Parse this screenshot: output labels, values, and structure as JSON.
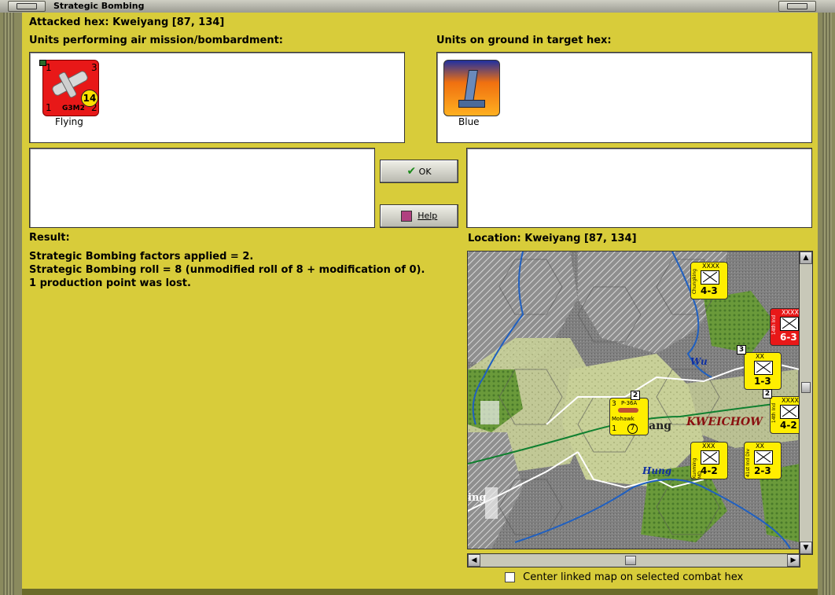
{
  "window": {
    "title": "Strategic Bombing"
  },
  "attacked_hex": "Attacked hex: Kweiyang  [87, 134]",
  "air_units": {
    "label": "Units performing air mission/bombardment:",
    "unit": {
      "type": "G3M2",
      "strength": "14",
      "top_left": "1",
      "top_right": "3",
      "bottom_left": "1",
      "bottom_right": "2",
      "caption": "Flying",
      "icon": "bomber-plane-icon"
    }
  },
  "ground_units": {
    "label": "Units on ground in target hex:",
    "unit": {
      "caption": "Blue",
      "icon": "factory-tower-icon"
    }
  },
  "buttons": {
    "ok": "OK",
    "help": "Help"
  },
  "result": {
    "label": "Result:",
    "lines": [
      "Strategic Bombing factors applied = 2.",
      "Strategic Bombing roll = 8 (unmodified roll of 8 + modification of 0).",
      "1 production point was lost."
    ]
  },
  "location": {
    "label": "Location:  Kweiyang  [87, 134]"
  },
  "map": {
    "labels": {
      "province": "KWEICHOW",
      "city_partial": "ang",
      "river1": "Wu",
      "river2": "Hung",
      "west_partial": "ing"
    },
    "units": [
      {
        "size": "XXXX",
        "values": "4-3",
        "side": "Chungking",
        "color": "yellow",
        "stack": ""
      },
      {
        "size": "XXXX",
        "values": "6-3",
        "side": "14th Ind",
        "color": "red",
        "stack": ""
      },
      {
        "size": "XX",
        "values": "1-3",
        "side": "",
        "color": "yellow",
        "stack": "3"
      },
      {
        "size": "XXXX",
        "values": "4-2",
        "side": "14th Ind",
        "color": "yellow",
        "stack": "2"
      },
      {
        "size": "XXX",
        "values": "4-2",
        "side": "Kunming MD",
        "color": "yellow",
        "stack": ""
      },
      {
        "size": "XX",
        "values": "2-3",
        "side": "41st Ind Div",
        "color": "yellow",
        "stack": ""
      }
    ],
    "air_unit": {
      "type": "P-36A",
      "name": "Mohawk",
      "top_left": "3",
      "bottom_left": "1",
      "range": "7",
      "stack": "2"
    }
  },
  "footer": {
    "checkbox_label": "Center linked map on selected combat hex",
    "checked": false
  },
  "colors": {
    "dialog_bg": "#d8cc3a",
    "air_counter": "#e81818",
    "unit_counter": "#ffee00"
  }
}
